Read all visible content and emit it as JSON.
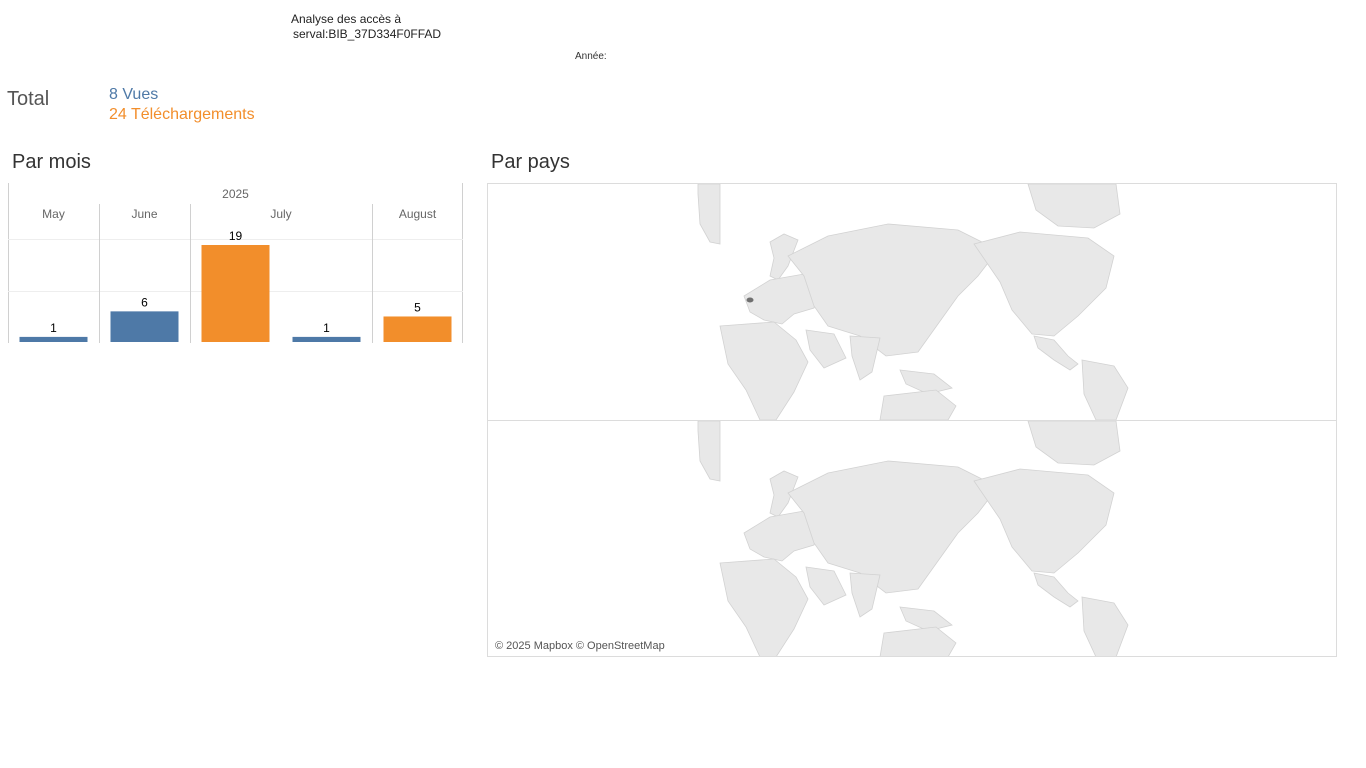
{
  "header": {
    "title_line1": "Analyse des accès à",
    "title_line2": "serval:BIB_37D334F0FFAD",
    "year_filter_label": "Année:"
  },
  "totals": {
    "label": "Total",
    "views": "8 Vues",
    "downloads": "24 Téléchargements"
  },
  "colors": {
    "views": "#4e79a7",
    "downloads": "#f28e2b",
    "land": "#e8e8e8",
    "highlight": "#6f6f6f"
  },
  "sections": {
    "by_month": "Par mois",
    "by_country": "Par pays"
  },
  "chart_data": {
    "type": "bar",
    "year": "2025",
    "categories": [
      "May",
      "June",
      "July",
      "July",
      "August"
    ],
    "month_groups": [
      {
        "label": "May",
        "bars": 1
      },
      {
        "label": "June",
        "bars": 1
      },
      {
        "label": "July",
        "bars": 2
      },
      {
        "label": "August",
        "bars": 1
      }
    ],
    "values": [
      1,
      6,
      19,
      1,
      5
    ],
    "value_labels": [
      "1",
      "6",
      "19",
      "1",
      "5"
    ],
    "bar_series": [
      "views",
      "views",
      "downloads",
      "views",
      "downloads"
    ],
    "ylim": [
      0,
      19
    ],
    "grid": true
  },
  "map": {
    "attribution": "© 2025 Mapbox © OpenStreetMap",
    "highlighted_country": "Switzerland"
  }
}
